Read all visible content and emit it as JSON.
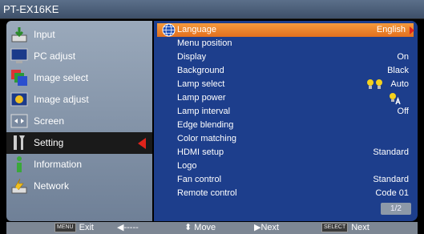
{
  "window": {
    "title": "PT-EX16KE"
  },
  "sidebar": {
    "items": [
      {
        "label": "Input",
        "icon": "input-icon"
      },
      {
        "label": "PC adjust",
        "icon": "pc-adjust-icon"
      },
      {
        "label": "Image select",
        "icon": "image-select-icon"
      },
      {
        "label": "Image adjust",
        "icon": "image-adjust-icon"
      },
      {
        "label": "Screen",
        "icon": "screen-icon"
      },
      {
        "label": "Setting",
        "icon": "setting-icon",
        "active": true
      },
      {
        "label": "Information",
        "icon": "information-icon"
      },
      {
        "label": "Network",
        "icon": "network-icon"
      }
    ]
  },
  "settings": {
    "rows": [
      {
        "name": "Language",
        "value": "English"
      },
      {
        "name": "Menu position",
        "value": ""
      },
      {
        "name": "Display",
        "value": "On"
      },
      {
        "name": "Background",
        "value": "Black"
      },
      {
        "name": "Lamp select",
        "value": "Auto"
      },
      {
        "name": "Lamp power",
        "value": ""
      },
      {
        "name": "Lamp interval",
        "value": "Off"
      },
      {
        "name": "Edge blending",
        "value": ""
      },
      {
        "name": "Color matching",
        "value": ""
      },
      {
        "name": "HDMI setup",
        "value": "Standard"
      },
      {
        "name": "Logo",
        "value": ""
      },
      {
        "name": "Fan control",
        "value": "Standard"
      },
      {
        "name": "Remote control",
        "value": "Code 01"
      }
    ],
    "page": "1/2"
  },
  "footer": {
    "menu_key": "MENU",
    "exit": "Exit",
    "back": "-----",
    "move": "Move",
    "next": "Next",
    "select_key": "SELECT",
    "select_next": "Next"
  },
  "colors": {
    "panel_blue": "#1d3e8c",
    "highlight_orange": "#ee8a30",
    "arrow_red": "#e0241b"
  }
}
